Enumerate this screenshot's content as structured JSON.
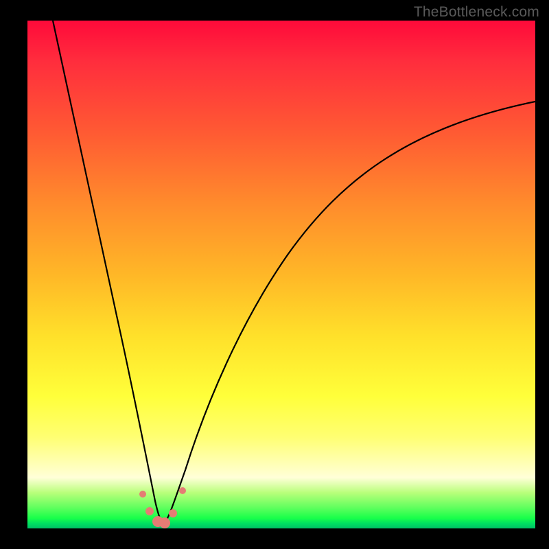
{
  "watermark": "TheBottleneck.com",
  "chart_data": {
    "type": "line",
    "title": "",
    "xlabel": "",
    "ylabel": "",
    "xlim": [
      0,
      100
    ],
    "ylim": [
      0,
      100
    ],
    "grid": false,
    "legend": false,
    "note": "Two-branch bottleneck curve: left branch descends from top-left to a minimum near x≈26, right branch rises toward top-right. Y scales with background hue (red≈100, green≈0).",
    "series": [
      {
        "name": "left_branch",
        "x": [
          5,
          8,
          11,
          14,
          17,
          20,
          23,
          25,
          26
        ],
        "values": [
          100,
          84,
          68,
          53,
          39,
          25,
          13,
          5,
          1
        ]
      },
      {
        "name": "right_branch",
        "x": [
          26,
          28,
          30,
          34,
          40,
          48,
          58,
          70,
          84,
          100
        ],
        "values": [
          1,
          4,
          8,
          18,
          30,
          43,
          56,
          67,
          76,
          82
        ]
      }
    ],
    "markers": [
      {
        "x": 22.0,
        "y": 8.0,
        "r": 5
      },
      {
        "x": 23.5,
        "y": 4.0,
        "r": 6
      },
      {
        "x": 25.0,
        "y": 2.0,
        "r": 7
      },
      {
        "x": 26.5,
        "y": 1.5,
        "r": 7
      },
      {
        "x": 28.0,
        "y": 3.0,
        "r": 6
      },
      {
        "x": 30.0,
        "y": 7.0,
        "r": 5
      }
    ]
  }
}
